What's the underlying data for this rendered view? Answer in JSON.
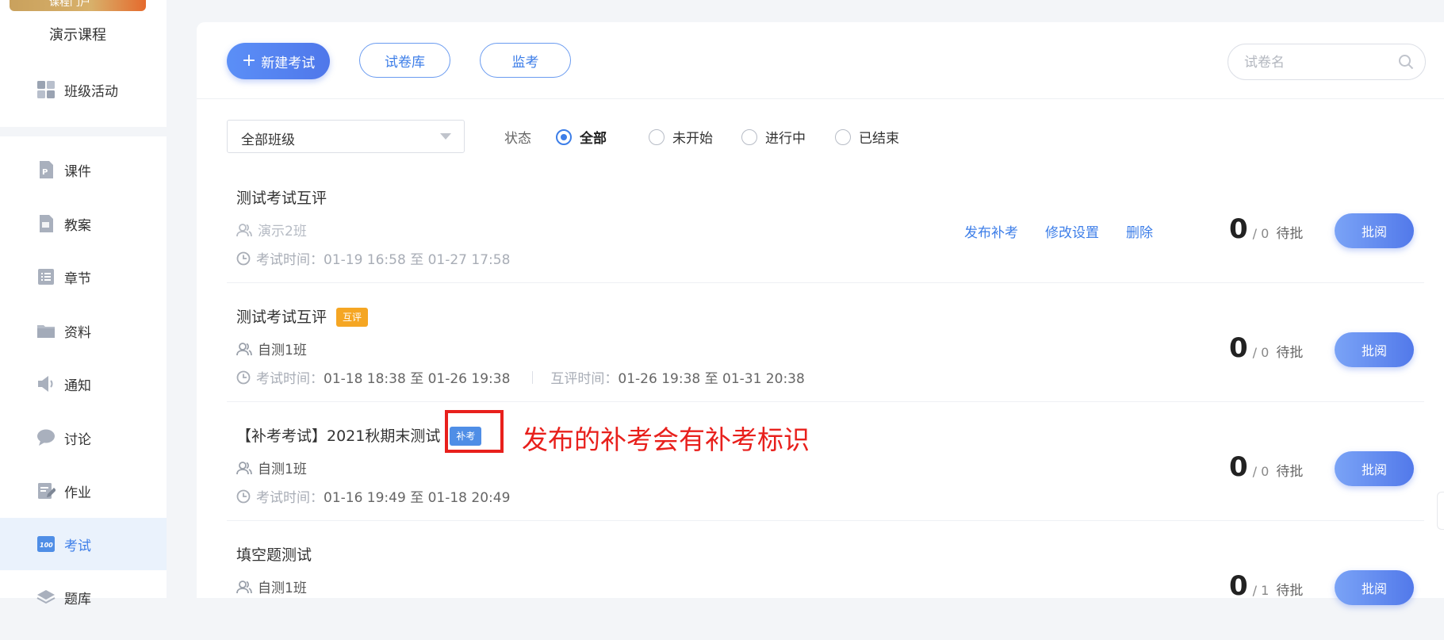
{
  "sidebar": {
    "cover_text": "课程门户",
    "course_name": "演示课程",
    "items": [
      {
        "label": "班级活动",
        "icon": "grid-icon"
      },
      {
        "label": "课件",
        "icon": "courseware-icon"
      },
      {
        "label": "教案",
        "icon": "lesson-plan-icon"
      },
      {
        "label": "章节",
        "icon": "chapter-list-icon"
      },
      {
        "label": "资料",
        "icon": "folder-icon"
      },
      {
        "label": "通知",
        "icon": "speaker-icon"
      },
      {
        "label": "讨论",
        "icon": "chat-bubble-icon"
      },
      {
        "label": "作业",
        "icon": "homework-edit-icon"
      },
      {
        "label": "考试",
        "icon": "exam-icon",
        "active": true
      },
      {
        "label": "题库",
        "icon": "question-bank-icon"
      }
    ]
  },
  "toolbar": {
    "new_exam": "新建考试",
    "paper_library": "试卷库",
    "proctor": "监考",
    "search_placeholder": "试卷名"
  },
  "filter": {
    "class_select": "全部班级",
    "status_label": "状态",
    "status_options": [
      "全部",
      "未开始",
      "进行中",
      "已结束"
    ],
    "status_selected": "全部"
  },
  "exams": [
    {
      "title": "测试考试互评",
      "class": "演示2班",
      "time_label": "考试时间：",
      "time_range": "01-19 16:58 至 01-27 17:58",
      "actions": [
        "发布补考",
        "修改设置",
        "删除"
      ],
      "count": "0",
      "total": "/ 0",
      "pending": "待批",
      "review": "批阅"
    },
    {
      "title": "测试考试互评",
      "tag": "互评",
      "class": "自测1班",
      "time_label": "考试时间：",
      "time_range": "01-18 18:38 至 01-26 19:38",
      "peer_label": "互评时间：",
      "peer_range": "01-26 19:38 至 01-31 20:38",
      "count": "0",
      "total": "/ 0",
      "pending": "待批",
      "review": "批阅"
    },
    {
      "title": "【补考考试】2021秋期末测试",
      "tag": "补考",
      "class": "自测1班",
      "time_label": "考试时间：",
      "time_range": "01-16 19:49 至 01-18 20:49",
      "count": "0",
      "total": "/ 0",
      "pending": "待批",
      "review": "批阅"
    },
    {
      "title": "填空题测试",
      "class": "自测1班",
      "count": "0",
      "total": "/ 1",
      "pending": "待批",
      "review": "批阅"
    }
  ],
  "annotation": {
    "text": "发布的补考会有补考标识",
    "color": "#e8201c"
  },
  "colors": {
    "accent": "#3d7ee8",
    "peer_tag": "#f5a623",
    "makeup_tag": "#4f8ee6"
  }
}
